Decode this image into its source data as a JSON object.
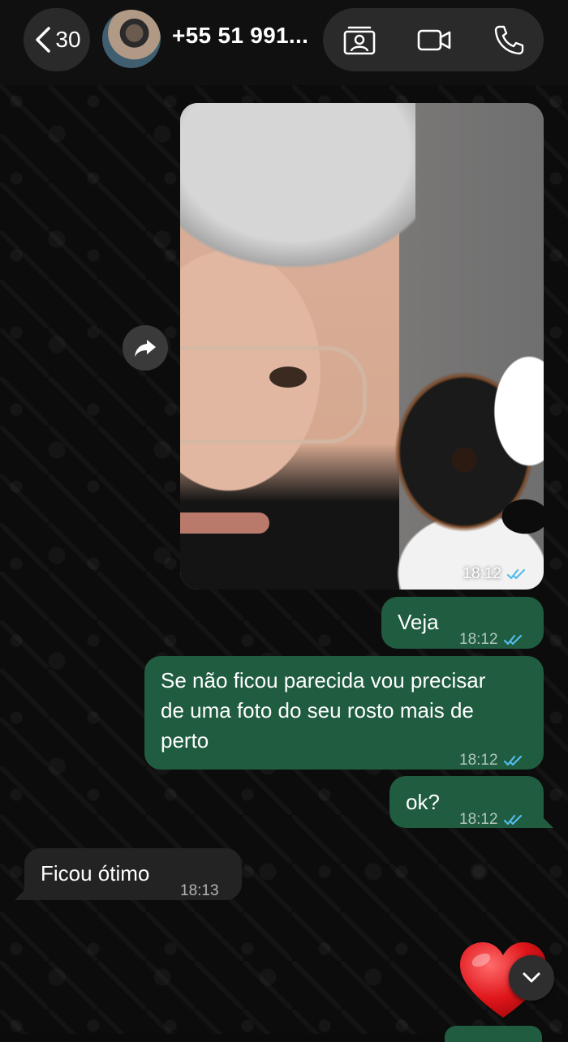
{
  "header": {
    "back_count": "30",
    "contact_name": "+55 51 991...",
    "icons": {
      "back": "chevron-left-icon",
      "contact_card": "contact-card-icon",
      "video": "video-camera-icon",
      "call": "phone-icon"
    }
  },
  "messages": [
    {
      "type": "image",
      "direction": "out",
      "time": "18:12",
      "status": "read"
    },
    {
      "type": "text",
      "direction": "out",
      "text": "Veja",
      "time": "18:12",
      "status": "read"
    },
    {
      "type": "text",
      "direction": "out",
      "lines": [
        "Se não ficou parecida vou precisar",
        "de uma foto do seu rosto mais de",
        "perto"
      ],
      "time": "18:12",
      "status": "read"
    },
    {
      "type": "text",
      "direction": "out",
      "text": "ok?",
      "time": "18:12",
      "status": "read"
    },
    {
      "type": "text",
      "direction": "in",
      "text": "Ficou ótimo",
      "time": "18:13"
    },
    {
      "type": "emoji",
      "direction": "out",
      "emoji": "heart-emoji"
    }
  ],
  "colors": {
    "outgoing_bubble": "#1f5c40",
    "incoming_bubble": "#232323",
    "read_ticks": "#53bdeb",
    "background": "#0b0b0b"
  }
}
